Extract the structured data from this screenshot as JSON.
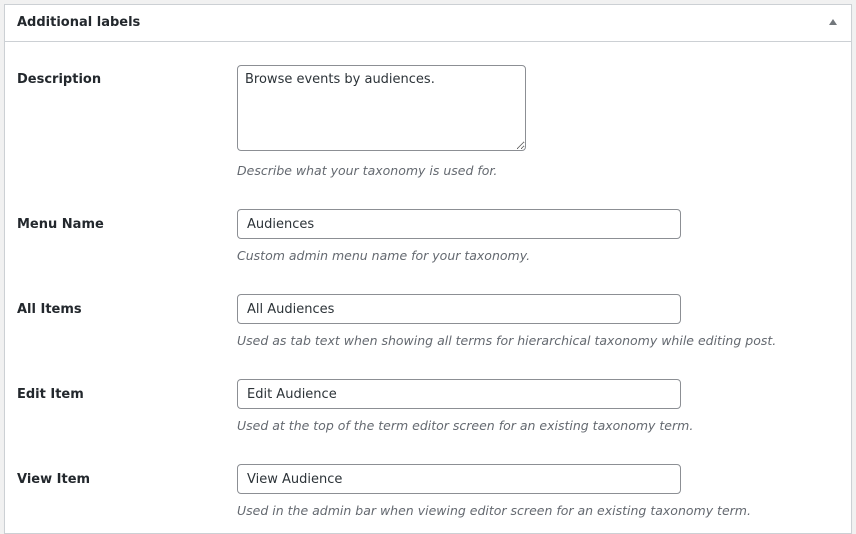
{
  "panel": {
    "title": "Additional labels",
    "toggle_icon": "arrow-up-icon"
  },
  "fields": {
    "description": {
      "label": "Description",
      "value": "Browse events by audiences.",
      "help": "Describe what your taxonomy is used for."
    },
    "menu_name": {
      "label": "Menu Name",
      "value": "Audiences",
      "help": "Custom admin menu name for your taxonomy."
    },
    "all_items": {
      "label": "All Items",
      "value": "All Audiences",
      "help": "Used as tab text when showing all terms for hierarchical taxonomy while editing post."
    },
    "edit_item": {
      "label": "Edit Item",
      "value": "Edit Audience",
      "help": "Used at the top of the term editor screen for an existing taxonomy term."
    },
    "view_item": {
      "label": "View Item",
      "value": "View Audience",
      "help": "Used in the admin bar when viewing editor screen for an existing taxonomy term."
    }
  }
}
